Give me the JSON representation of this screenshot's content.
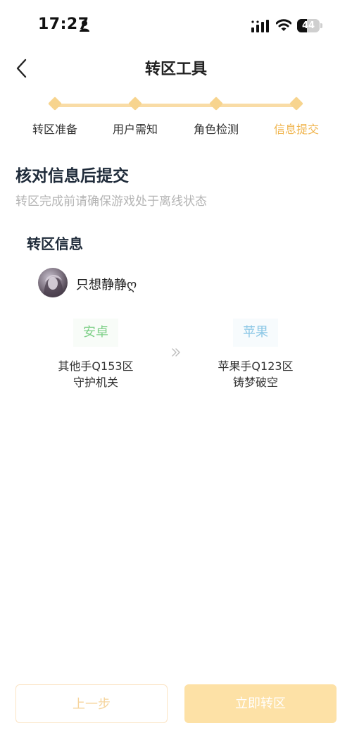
{
  "status_bar": {
    "time": "17:27",
    "battery": "44",
    "battery_level": 0.44
  },
  "nav": {
    "title": "转区工具",
    "back_icon": "chevron-left-icon"
  },
  "stepper": {
    "steps": [
      {
        "label": "转区准备",
        "active": false
      },
      {
        "label": "用户需知",
        "active": false
      },
      {
        "label": "角色检测",
        "active": false
      },
      {
        "label": "信息提交",
        "active": true
      }
    ],
    "active_color": "#f0b44c",
    "line_color": "#f9dca6"
  },
  "main": {
    "heading": "核对信息后提交",
    "subheading": "转区完成前请确保游戏处于离线状态"
  },
  "transfer_info": {
    "section_title": "转区信息",
    "username": "只想静静ღ",
    "source": {
      "platform": "安卓",
      "platform_color": "#7dcf87",
      "server_line1": "其他手Q153区",
      "server_line2": "守护机关"
    },
    "target": {
      "platform": "苹果",
      "platform_color": "#8bc7e6",
      "server_line1": "苹果手Q123区",
      "server_line2": "铸梦破空"
    },
    "arrow_icon": "double-chevron-right-icon"
  },
  "buttons": {
    "prev_label": "上一步",
    "submit_label": "立即转区"
  }
}
